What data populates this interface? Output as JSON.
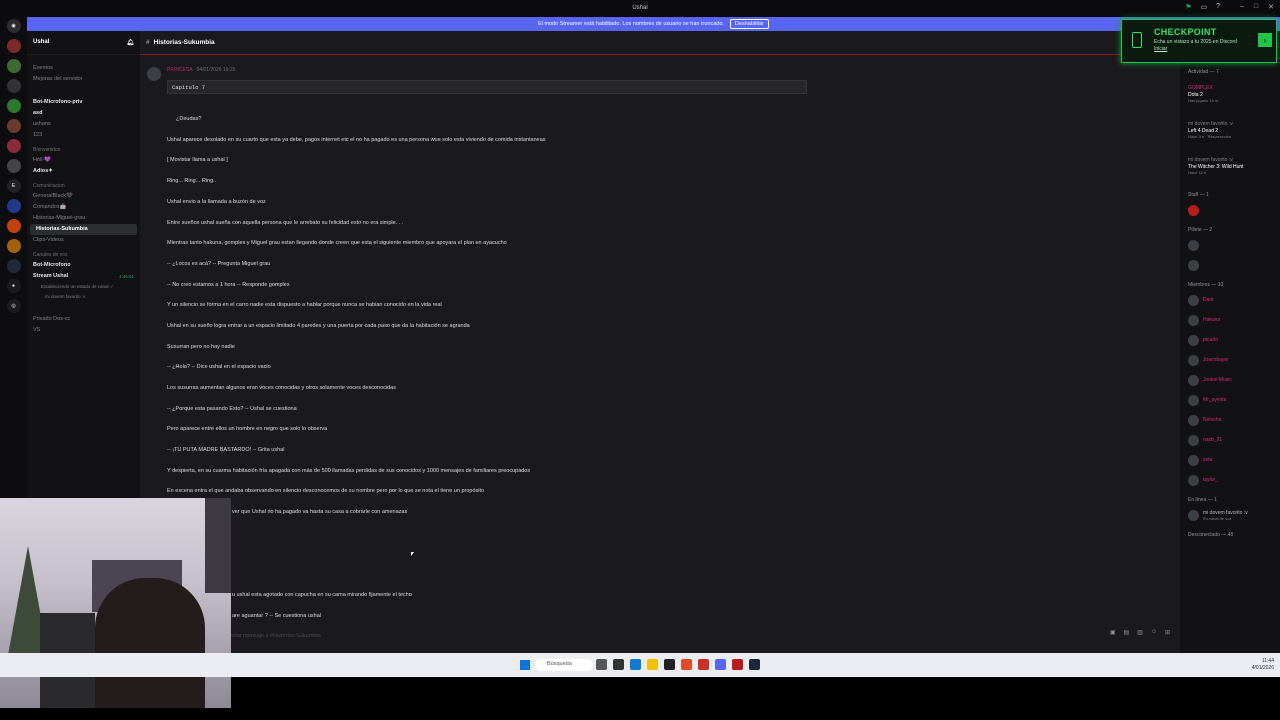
{
  "window": {
    "title": "Ushal",
    "banner_text": "El modo Streamer está habilitado. Los nombres de usuario se han truncado.",
    "banner_button": "Deshabilitar"
  },
  "server": {
    "name": "Ushal",
    "top_items": [
      "Eventos",
      "Mejoras del servidor"
    ],
    "channels": [
      {
        "label": "Bot-Microfono-priv",
        "style": "bold"
      },
      {
        "label": "asd",
        "style": "bold"
      },
      {
        "label": "ushans",
        "style": "normal"
      },
      {
        "label": "123",
        "style": "normal"
      }
    ],
    "category_bienvenidos": "Bienvenidos",
    "bienvenidos_channels": [
      "Holi-💜",
      "Adios✦"
    ],
    "category_comunicacion": "Comunicacion",
    "comunicacion_channels": [
      "GeneralBlack🖤",
      "Comandos🤖",
      "Historias-Miguel-grau",
      "Historias-Sukumbia",
      "Clips-Videos"
    ],
    "category_voz": "Canales de voz",
    "voice_channels": [
      "Bot-Microfono",
      "Stream Ushal",
      "Privado Dos-cc",
      "VS"
    ],
    "stream_status": "Estableciendo un estado de canal ✓",
    "stream_time": "4:46:01",
    "stream_user": "mi dovem favorito :v"
  },
  "channel": {
    "name": "Historias-Sukumbia",
    "composer_placeholder": "Enviar mensaje a #Historias-Sukumbia"
  },
  "message": {
    "author": "PRINCESA",
    "timestamp": "04/01/2026 19:26",
    "code": "Capitulo 7",
    "lines": [
      "¿Deudas?",
      "Ushal aparece desolado en su cuarto que esta ya debe, pagos internet etc el no ha pagado es una persona wue solo esta viviendo de comida instantaneas",
      "[ Movistar llama a ushal ]",
      "Ring... Ring... Ring..",
      "Ushal envio a la llamada a buzón de voz",
      "Entre sueños ushal sueña con aquella persona que le arrebato su felicidad esto no era simple. . .",
      "Mientras tanto hakuna, gomplex y Miguel grau estan llegando donde creen que esta el siguiente miembro que apoyara el plan en ayacucho",
      "-- ¿Locos es acá? -- Pregunta Miguel grau",
      "-- No creo estamos a 1 hora -- Responde gomplex",
      "Y un silencio se forma en el carro nadie esta dispuesto a hablar porque nunca se habian conocido en la vida real",
      "Ushal en su sueño logra entrar a un espacio limitado 4 paredes y una puerta por cada paso que da la habitación se agranda",
      "Susurran pero no hay nadie",
      "-- ¿Hola? -- Dice ushal en el espacio vacio",
      "Los susurras aumentan algunos eran voces conocidas y otros solamente voces desconocidas",
      "-- ¿Porque esta pasando Esto? -- Ushal se cuestiona",
      "Pero aparece entre ellos un hombre en negro que solo lo observa",
      "-- ¡TU PUTA MADRE BASTARDO! -- Grita ushal",
      "Y despierta, en su cuarma habitación fría apagada con más de 500 llamadas perdidas de sus conocidos y 1000 mensajes de familiares preocupados",
      "En escena entra el que andaba observando en silencio desconocemos de su nombre pero por lo que se nota el tiene un propósito",
      "ver que Ushal no ha pagado va hasta su casa a cobrarle con amenazas",
      "u ushal esta agotado con capucha en su cama mirando fijamente el techo",
      "are aguantar ? -- Se cuestiona ushal"
    ]
  },
  "checkpoint": {
    "title": "CHECKPOINT",
    "subtitle": "Echa un vistazo a tu 2025 en Discord",
    "link": "Iniciar"
  },
  "members": {
    "activity_header": "Actividad — 7",
    "activities": [
      {
        "user": "GOMPLEX",
        "game": "Dota 2",
        "detail": "Has jugado 16 m"
      },
      {
        "user": "mi dovem favorito :v",
        "game": "Left 4 Dead 2",
        "detail": "Hace 3 h · Resurrección"
      },
      {
        "user": "mi dovem favorito :v",
        "game": "The Witcher 3: Wild Hunt",
        "detail": "Hace 12 h"
      }
    ],
    "staff_header": "Staff — 1",
    "pillete_header": "Pillete — 2",
    "miembros_header": "Miembros — 10",
    "members_list": [
      "Dani",
      "Hakuna",
      "ptcarlo",
      "Joacobayer",
      "Jookie Music",
      "Mr_ayesta",
      "Nelsoho",
      "nazb_21",
      "zeta",
      "taylor_"
    ],
    "online_header": "En línea — 1",
    "online_user": "mi dovem favorito :v",
    "online_sub": "En canal de voz",
    "offline_header": "Desconectado — 48"
  },
  "taskbar": {
    "search_placeholder": "Búsqueda",
    "time": "11:44",
    "date": "4/01/2026"
  },
  "colors": {
    "accent": "#5865f2",
    "author": "#c0226a",
    "checkpoint_green": "#1fc348"
  }
}
